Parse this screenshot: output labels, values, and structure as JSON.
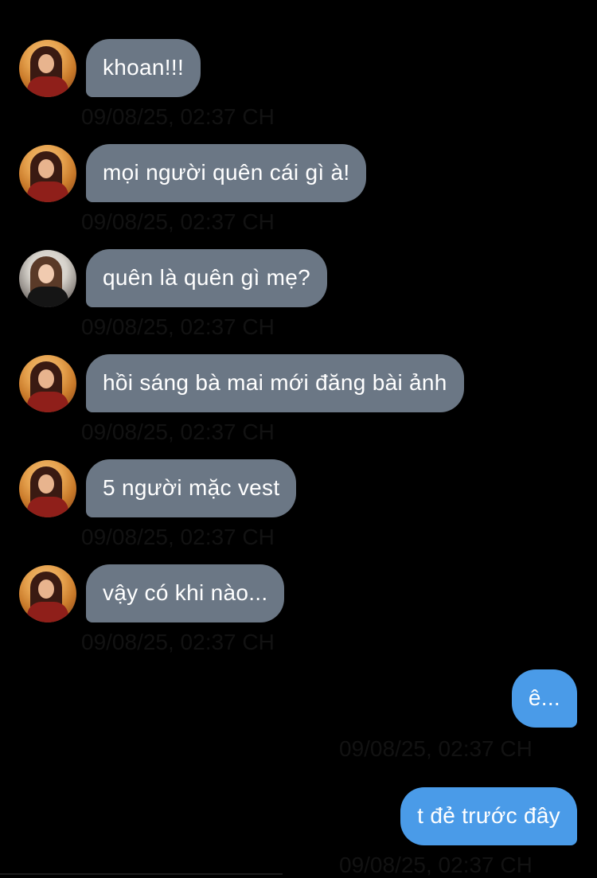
{
  "messages": [
    {
      "id": "m1",
      "side": "in",
      "avatar": "avatar-girl-red-dress",
      "text": "khoan!!!",
      "time": "09/08/25, 02:37 CH"
    },
    {
      "id": "m2",
      "side": "in",
      "avatar": "avatar-girl-red-dress",
      "text": "mọi người quên cái gì à!",
      "time": "09/08/25, 02:37 CH"
    },
    {
      "id": "m3",
      "side": "in",
      "avatar": "avatar-girl-black-dress",
      "text": "quên là quên gì mẹ?",
      "time": "09/08/25, 02:37 CH"
    },
    {
      "id": "m4",
      "side": "in",
      "avatar": "avatar-girl-red-dress",
      "text": "hồi sáng bà mai mới đăng bài ảnh",
      "time": "09/08/25, 02:37 CH"
    },
    {
      "id": "m5",
      "side": "in",
      "avatar": "avatar-girl-red-dress",
      "text": "5 người mặc vest",
      "time": "09/08/25, 02:37 CH"
    },
    {
      "id": "m6",
      "side": "in",
      "avatar": "avatar-girl-red-dress",
      "text": "vậy có khi nào...",
      "time": "09/08/25, 02:37 CH"
    },
    {
      "id": "m7",
      "side": "out",
      "text": "ê...",
      "time": "09/08/25, 02:37 CH"
    },
    {
      "id": "m8",
      "side": "out",
      "text": "t đẻ trước đây",
      "time": "09/08/25, 02:37 CH"
    }
  ],
  "colors": {
    "background": "#000000",
    "incoming_bubble": "#6b7785",
    "outgoing_bubble": "#4a9be8",
    "bubble_text": "#ffffff",
    "timestamp": "#121212"
  }
}
